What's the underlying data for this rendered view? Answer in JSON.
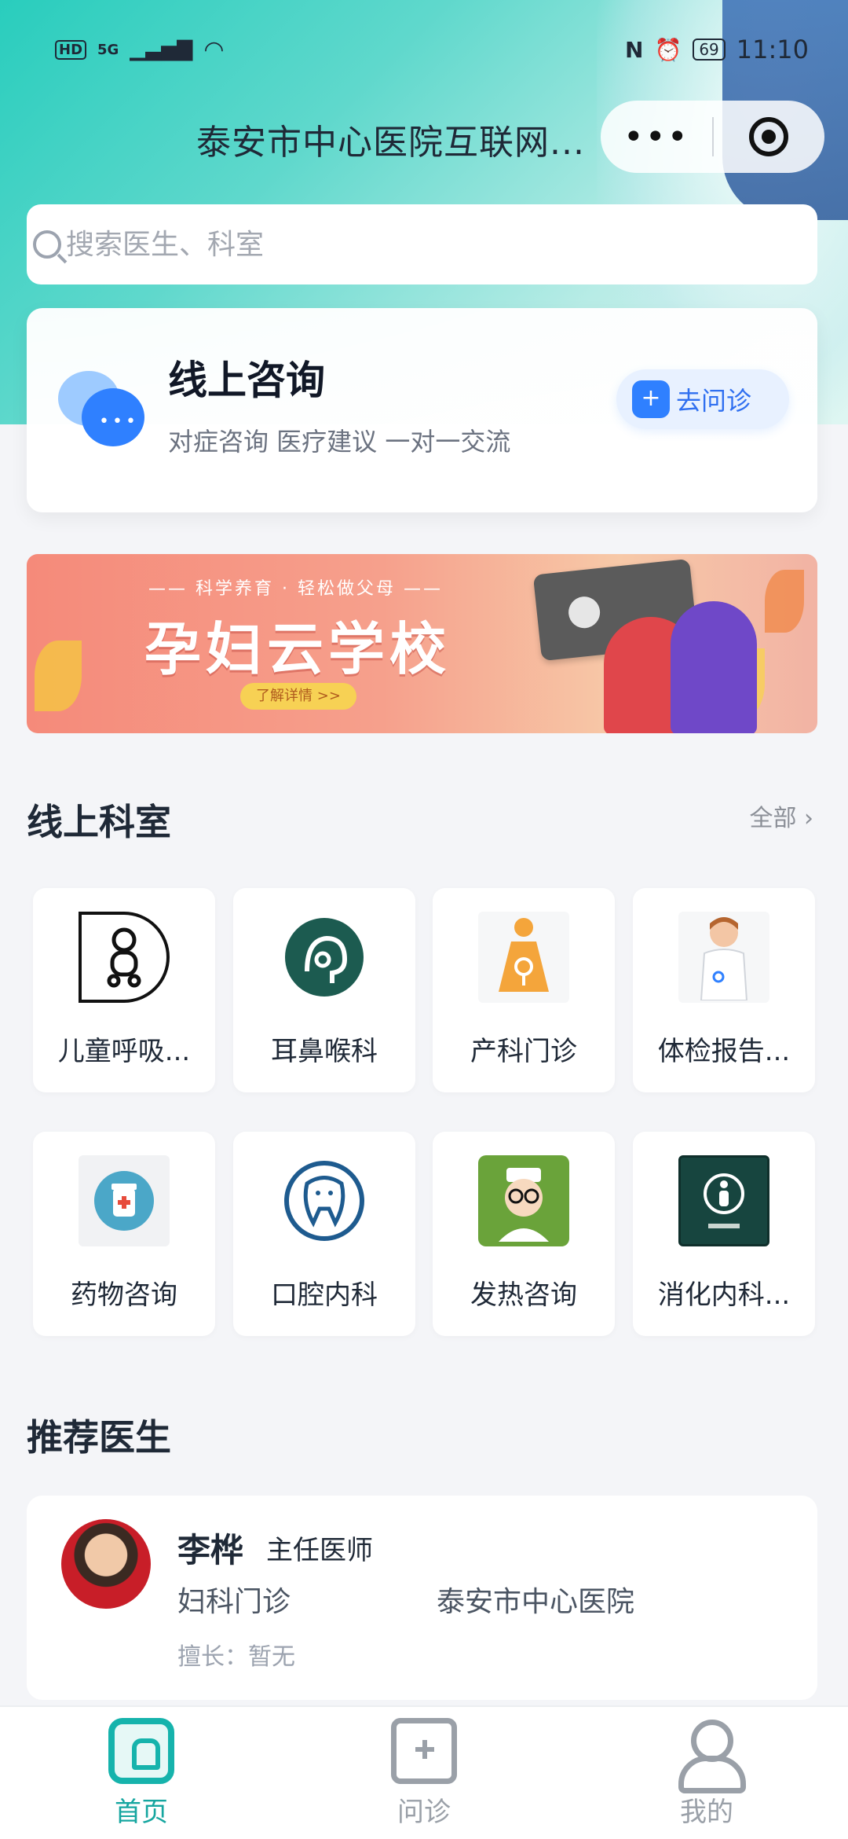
{
  "status_bar": {
    "left": {
      "hd": "HD",
      "network": "5G"
    },
    "right": {
      "battery": "69",
      "time": "11:10"
    }
  },
  "header": {
    "title": "泰安市中心医院互联网...",
    "capsule_more": "•••"
  },
  "search": {
    "placeholder": "搜索医生、科室"
  },
  "consult_card": {
    "title": "线上咨询",
    "subtitle": "对症咨询 医疗建议 一对一交流",
    "button": "去问诊"
  },
  "banner": {
    "tagline": "—— 科学养育 · 轻松做父母 ——",
    "title": "孕妇云学校",
    "button": "了解详情 >>"
  },
  "departments": {
    "section_title": "线上科室",
    "see_all": "全部 ›",
    "items": [
      {
        "label": "儿童呼吸...",
        "icon": "baby-icon"
      },
      {
        "label": "耳鼻喉科",
        "icon": "ent-head-icon"
      },
      {
        "label": "产科门诊",
        "icon": "pregnant-woman-icon"
      },
      {
        "label": "体检报告...",
        "icon": "nurse-icon"
      },
      {
        "label": "药物咨询",
        "icon": "medicine-bottle-icon"
      },
      {
        "label": "口腔内科",
        "icon": "tooth-icon"
      },
      {
        "label": "发热咨询",
        "icon": "doctor-cartoon-icon"
      },
      {
        "label": "消化内科...",
        "icon": "digestive-icon"
      }
    ]
  },
  "doctors": {
    "section_title": "推荐医生",
    "items": [
      {
        "name": "李桦",
        "rank": "主任医师",
        "department": "妇科门诊",
        "hospital": "泰安市中心医院",
        "specialty": "擅长：暂无"
      }
    ]
  },
  "tabbar": {
    "items": [
      {
        "label": "首页",
        "icon": "home-icon",
        "active": true
      },
      {
        "label": "问诊",
        "icon": "consult-plus-icon",
        "active": false
      },
      {
        "label": "我的",
        "icon": "profile-icon",
        "active": false
      }
    ]
  },
  "colors": {
    "brand": "#16b3ac",
    "accent_blue": "#2f80ff"
  }
}
